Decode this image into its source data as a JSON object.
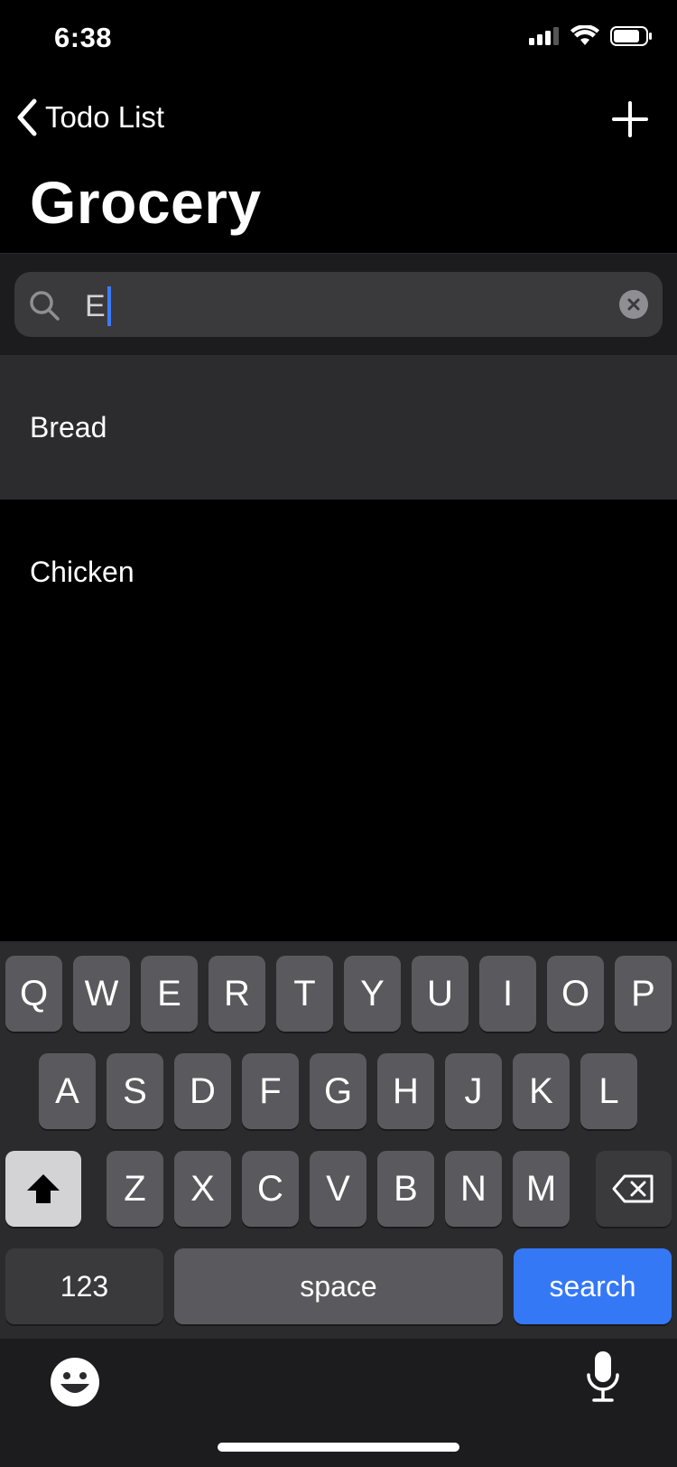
{
  "status_bar": {
    "time": "6:38"
  },
  "nav": {
    "back_label": "Todo List",
    "title": "Grocery"
  },
  "search": {
    "value": "E"
  },
  "list": {
    "items": [
      "Bread",
      "Chicken"
    ]
  },
  "keyboard": {
    "row1": [
      "Q",
      "W",
      "E",
      "R",
      "T",
      "Y",
      "U",
      "I",
      "O",
      "P"
    ],
    "row2": [
      "A",
      "S",
      "D",
      "F",
      "G",
      "H",
      "J",
      "K",
      "L"
    ],
    "row3": [
      "Z",
      "X",
      "C",
      "V",
      "B",
      "N",
      "M"
    ],
    "numbers_label": "123",
    "space_label": "space",
    "search_label": "search"
  },
  "colors": {
    "accent": "#3478f6",
    "caret": "#3d7bf5"
  }
}
